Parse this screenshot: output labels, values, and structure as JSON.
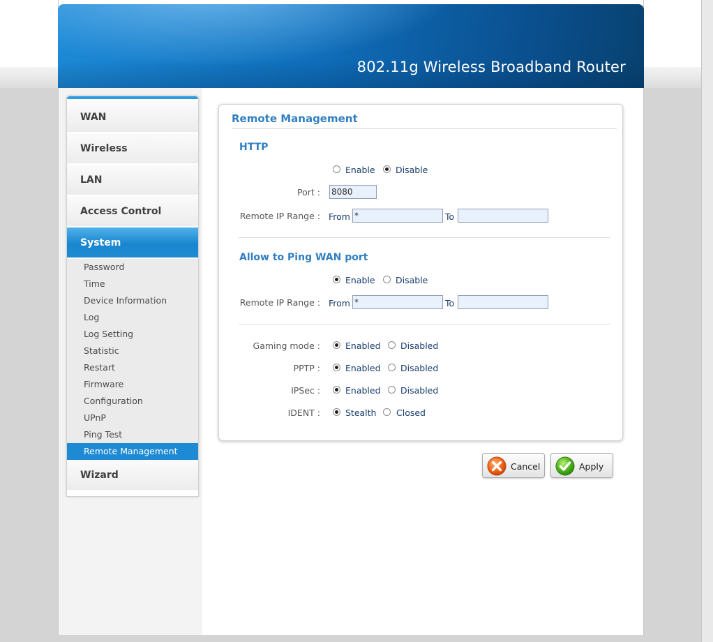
{
  "header": {
    "title": "802.11g Wireless Broadband Router"
  },
  "sidebar": {
    "items": [
      {
        "label": "WAN"
      },
      {
        "label": "Wireless"
      },
      {
        "label": "LAN"
      },
      {
        "label": "Access Control"
      },
      {
        "label": "System",
        "active": true
      },
      {
        "label": "Wizard"
      }
    ],
    "system_submenu": [
      "Password",
      "Time",
      "Device Information",
      "Log",
      "Log Setting",
      "Statistic",
      "Restart",
      "Firmware",
      "Configuration",
      "UPnP",
      "Ping Test",
      "Remote Management"
    ],
    "active_sub": "Remote Management"
  },
  "panel": {
    "title": "Remote Management",
    "http": {
      "title": "HTTP",
      "enable_label": "Enable",
      "disable_label": "Disable",
      "selected": "Disable",
      "port_label": "Port :",
      "port_value": "8080",
      "range_label": "Remote IP Range :",
      "from_label": "From",
      "from_value": "*",
      "to_label": "To",
      "to_value": ""
    },
    "ping": {
      "title": "Allow to Ping WAN port",
      "enable_label": "Enable",
      "disable_label": "Disable",
      "selected": "Enable",
      "range_label": "Remote IP Range :",
      "from_label": "From",
      "from_value": "*",
      "to_label": "To",
      "to_value": ""
    },
    "options": {
      "gaming_label": "Gaming mode :",
      "pptp_label": "PPTP :",
      "ipsec_label": "IPSec :",
      "ident_label": "IDENT :",
      "enabled_label": "Enabled",
      "disabled_label": "Disabled",
      "stealth_label": "Stealth",
      "closed_label": "Closed"
    }
  },
  "buttons": {
    "cancel": "Cancel",
    "apply": "Apply"
  },
  "colors": {
    "accent": "#2f7fc1",
    "active_nav": "#1e8ad3"
  }
}
